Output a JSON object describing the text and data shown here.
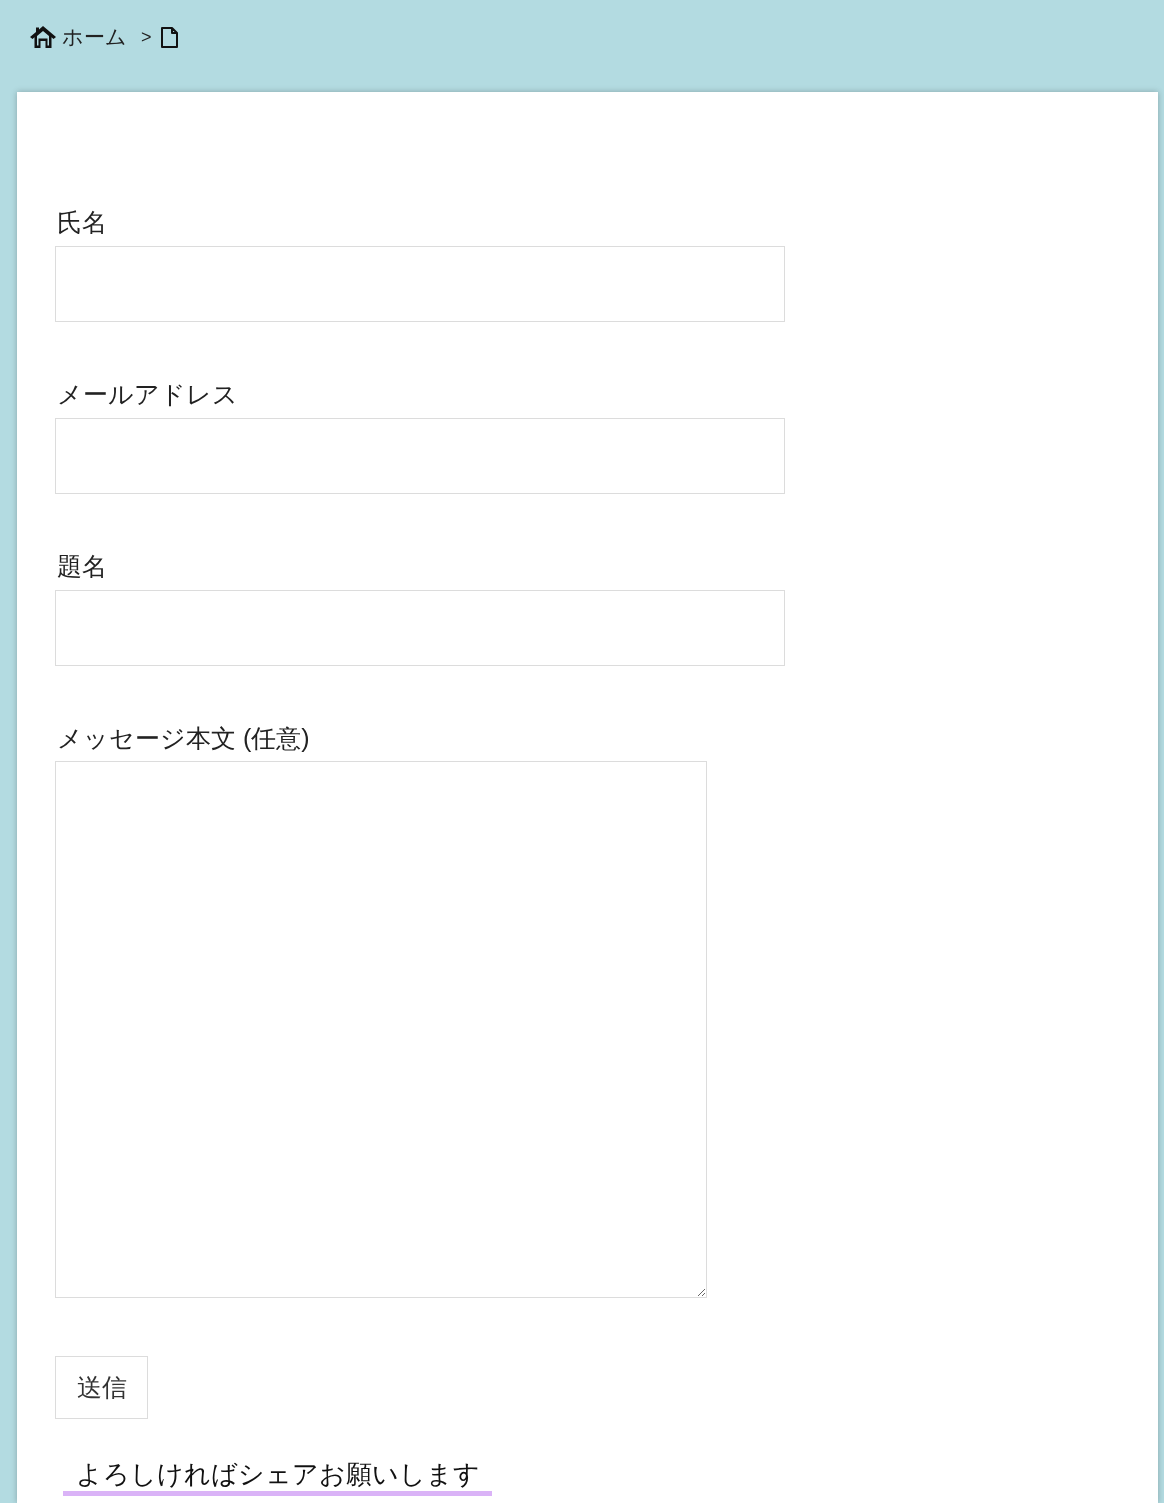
{
  "breadcrumb": {
    "home": "ホーム",
    "separator": ">"
  },
  "form": {
    "fields": [
      {
        "kind": "input",
        "label": "氏名"
      },
      {
        "kind": "input",
        "label": "メールアドレス"
      },
      {
        "kind": "input",
        "label": "題名"
      },
      {
        "kind": "textarea",
        "label": "メッセージ本文 (任意)"
      }
    ],
    "submit": "送信"
  },
  "share": {
    "heading": "よろしければシェアお願いします"
  }
}
